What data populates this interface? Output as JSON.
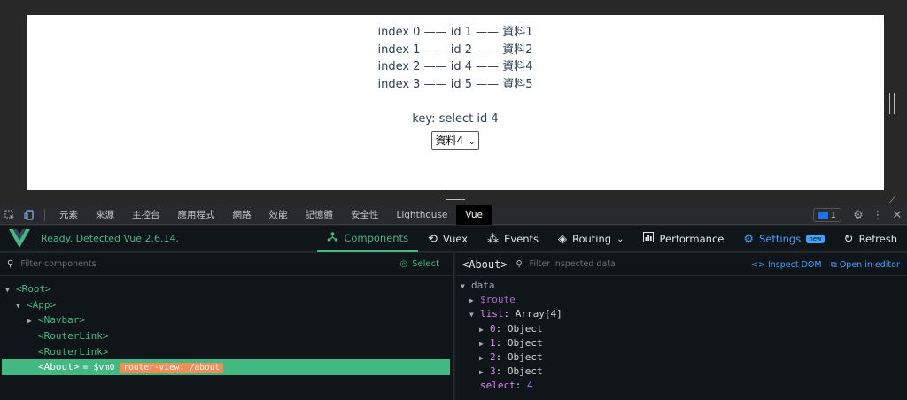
{
  "page": {
    "rows": [
      "index 0 —— id 1 —— 資料1",
      "index 1 —— id 2 —— 資料2",
      "index 2 —— id 4 —— 資料4",
      "index 3 —— id 5 —— 資料5"
    ],
    "key_text": "key: select id 4",
    "select_value": "資料4"
  },
  "devtools_tabs": [
    "元素",
    "來源",
    "主控台",
    "應用程式",
    "網路",
    "效能",
    "記憶體",
    "安全性",
    "Lighthouse",
    "Vue"
  ],
  "devtools_active_tab": "Vue",
  "message_count": "1",
  "vue_toolbar": {
    "status": "Ready. Detected Vue 2.6.14.",
    "nav": {
      "components": "Components",
      "vuex": "Vuex",
      "events": "Events",
      "routing": "Routing",
      "performance": "Performance",
      "settings": "Settings",
      "new_badge": "new",
      "refresh": "Refresh"
    }
  },
  "components_panel": {
    "filter_placeholder": "Filter components",
    "select_label": "Select",
    "tree": {
      "root": "<Root>",
      "app": "<App>",
      "navbar": "<Navbar>",
      "routerlink1": "<RouterLink>",
      "routerlink2": "<RouterLink>",
      "about": "<About>",
      "about_vm": "= $vm0",
      "about_tag": "router-view: /about"
    }
  },
  "inspector": {
    "component_name": "<About>",
    "filter_placeholder": "Filter inspected data",
    "inspect_dom": "Inspect DOM",
    "open_in_editor": "Open in editor",
    "section": "data",
    "route_key": "$route",
    "list_key": "list",
    "list_type": "Array[4]",
    "items": [
      "0",
      "1",
      "2",
      "3"
    ],
    "item_value": "Object",
    "select_key": "select",
    "select_value": "4"
  },
  "colors": {
    "vue_green": "#42b883",
    "accent_blue": "#41a2ff",
    "router_tag": "#f28b54"
  }
}
